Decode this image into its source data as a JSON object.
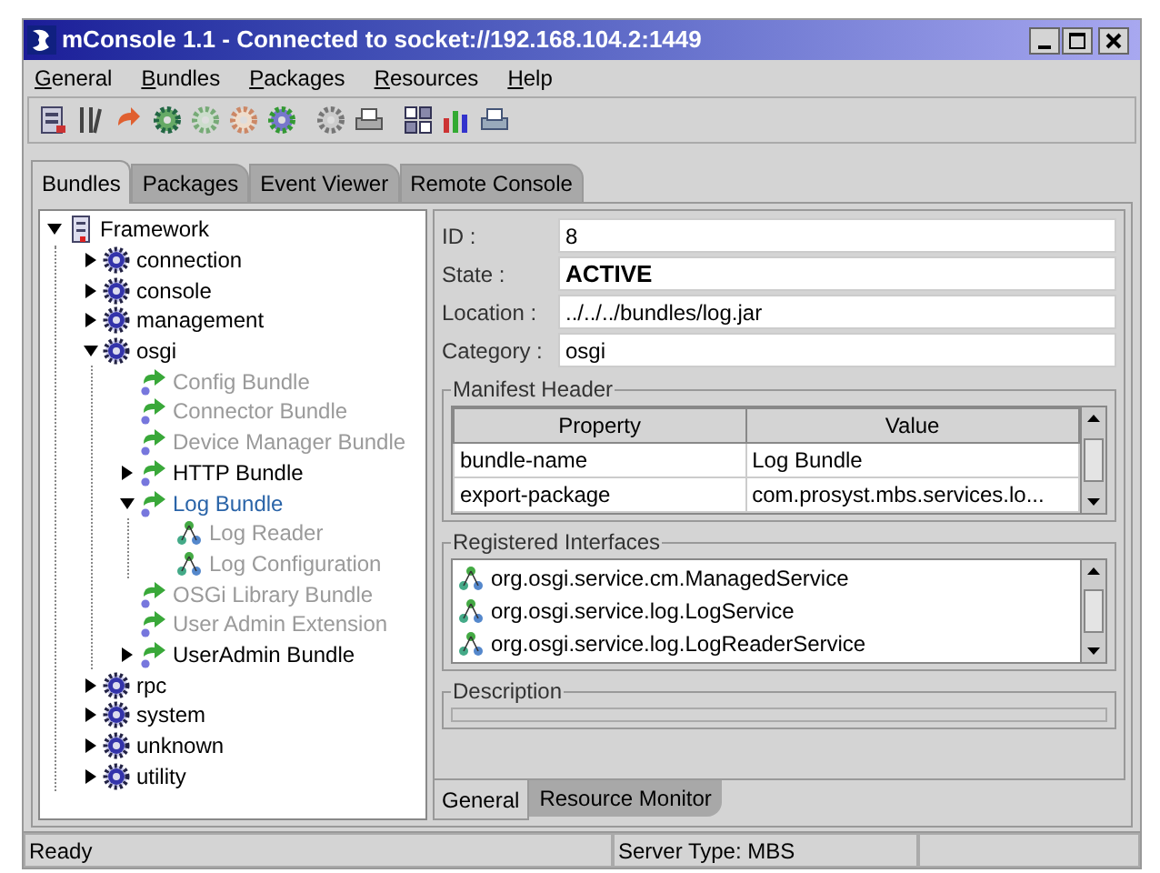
{
  "window": {
    "title": "mConsole 1.1 - Connected to socket://192.168.104.2:1449"
  },
  "menu": [
    "General",
    "Bundles",
    "Packages",
    "Resources",
    "Help"
  ],
  "tabs": [
    {
      "label": "Bundles",
      "selected": true
    },
    {
      "label": "Packages",
      "selected": false
    },
    {
      "label": "Event Viewer",
      "selected": false
    },
    {
      "label": "Remote Console",
      "selected": false
    }
  ],
  "tree": [
    {
      "label": "Framework",
      "kind": "framework",
      "expanded": true,
      "children": [
        {
          "label": "connection",
          "kind": "category",
          "expanded": false
        },
        {
          "label": "console",
          "kind": "category",
          "expanded": false
        },
        {
          "label": "management",
          "kind": "category",
          "expanded": false
        },
        {
          "label": "osgi",
          "kind": "category",
          "expanded": true,
          "children": [
            {
              "label": "Config Bundle",
              "kind": "bundle",
              "disabled": true,
              "selected": false
            },
            {
              "label": "Connector Bundle",
              "kind": "bundle",
              "disabled": true,
              "selected": false
            },
            {
              "label": "Device Manager Bundle",
              "kind": "bundle",
              "disabled": true,
              "selected": false
            },
            {
              "label": "HTTP Bundle",
              "kind": "bundle",
              "disabled": false,
              "selected": false,
              "expanded": false
            },
            {
              "label": "Log Bundle",
              "kind": "bundle",
              "selected": true,
              "expanded": true,
              "children": [
                {
                  "label": "Log Reader",
                  "kind": "service",
                  "disabled": true
                },
                {
                  "label": "Log Configuration",
                  "kind": "service",
                  "disabled": true
                }
              ]
            },
            {
              "label": "OSGi Library Bundle",
              "kind": "bundle",
              "disabled": true,
              "selected": false
            },
            {
              "label": "User Admin Extension",
              "kind": "bundle",
              "disabled": true,
              "selected": false
            },
            {
              "label": "UserAdmin Bundle",
              "kind": "bundle",
              "disabled": false,
              "selected": false,
              "expanded": false
            }
          ]
        },
        {
          "label": "rpc",
          "kind": "category",
          "expanded": false
        },
        {
          "label": "system",
          "kind": "category",
          "expanded": false
        },
        {
          "label": "unknown",
          "kind": "category",
          "expanded": false
        },
        {
          "label": "utility",
          "kind": "category",
          "expanded": false
        }
      ]
    }
  ],
  "details": [
    {
      "label": "ID :",
      "value": "8",
      "bold": false
    },
    {
      "label": "State :",
      "value": "ACTIVE",
      "bold": true
    },
    {
      "label": "Location :",
      "value": "../../../bundles/log.jar",
      "bold": false
    },
    {
      "label": "Category :",
      "value": "osgi",
      "bold": false
    }
  ],
  "manifest_header": {
    "title": "Manifest Header",
    "columns": [
      "Property",
      "Value"
    ],
    "rows": [
      [
        "bundle-name",
        "Log Bundle"
      ],
      [
        "export-package",
        "com.prosyst.mbs.services.lo..."
      ]
    ]
  },
  "registered_interfaces": {
    "title": "Registered Interfaces",
    "items": [
      "org.osgi.service.cm.ManagedService",
      "org.osgi.service.log.LogService",
      "org.osgi.service.log.LogReaderService"
    ]
  },
  "description": {
    "title": "Description"
  },
  "detail_tabs": [
    {
      "label": "General",
      "selected": true
    },
    {
      "label": "Resource Monitor",
      "selected": false
    }
  ],
  "status_bar": [
    "Ready",
    "Server Type: MBS"
  ]
}
